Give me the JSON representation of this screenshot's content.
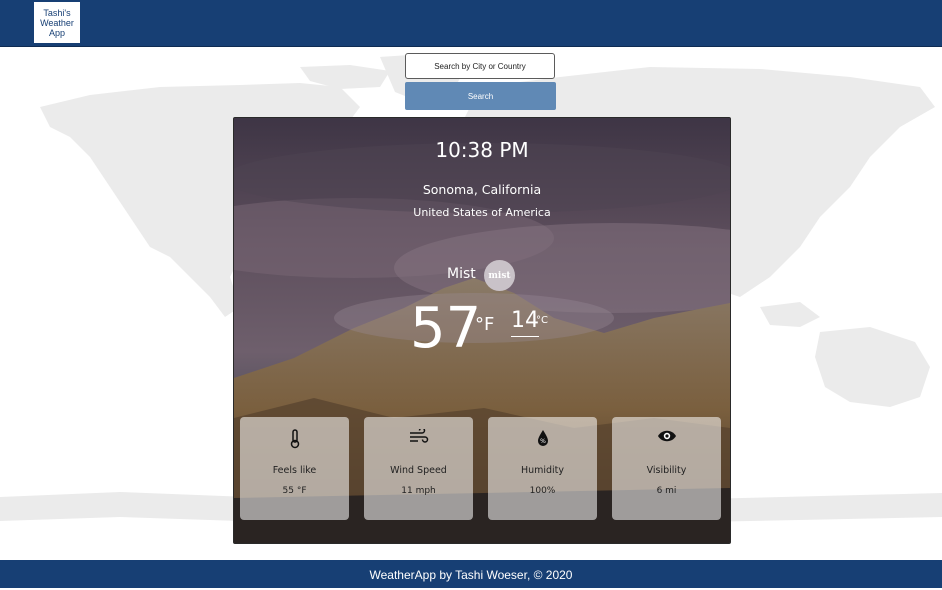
{
  "header": {
    "logo_text": "Tashi's Weather App"
  },
  "search": {
    "placeholder": "Search by City or Country",
    "button_label": "Search"
  },
  "weather": {
    "time": "10:38 PM",
    "city": "Sonoma, California",
    "country": "United States of America",
    "condition": "Mist",
    "condition_icon_text": "mist",
    "temp_f": "57",
    "unit_f": "°F",
    "temp_c": "14",
    "unit_c": "°C"
  },
  "stats": [
    {
      "icon": "thermometer-icon",
      "label": "Feels like",
      "value": "55 °F"
    },
    {
      "icon": "wind-icon",
      "label": "Wind Speed",
      "value": "11 mph"
    },
    {
      "icon": "humidity-drop-icon",
      "label": "Humidity",
      "value": "100%"
    },
    {
      "icon": "eye-icon",
      "label": "Visibility",
      "value": "6 mi"
    }
  ],
  "footer": {
    "text": "WeatherApp by Tashi Woeser, © 2020"
  },
  "colors": {
    "brand": "#173f74",
    "search_button": "#6089b5"
  }
}
